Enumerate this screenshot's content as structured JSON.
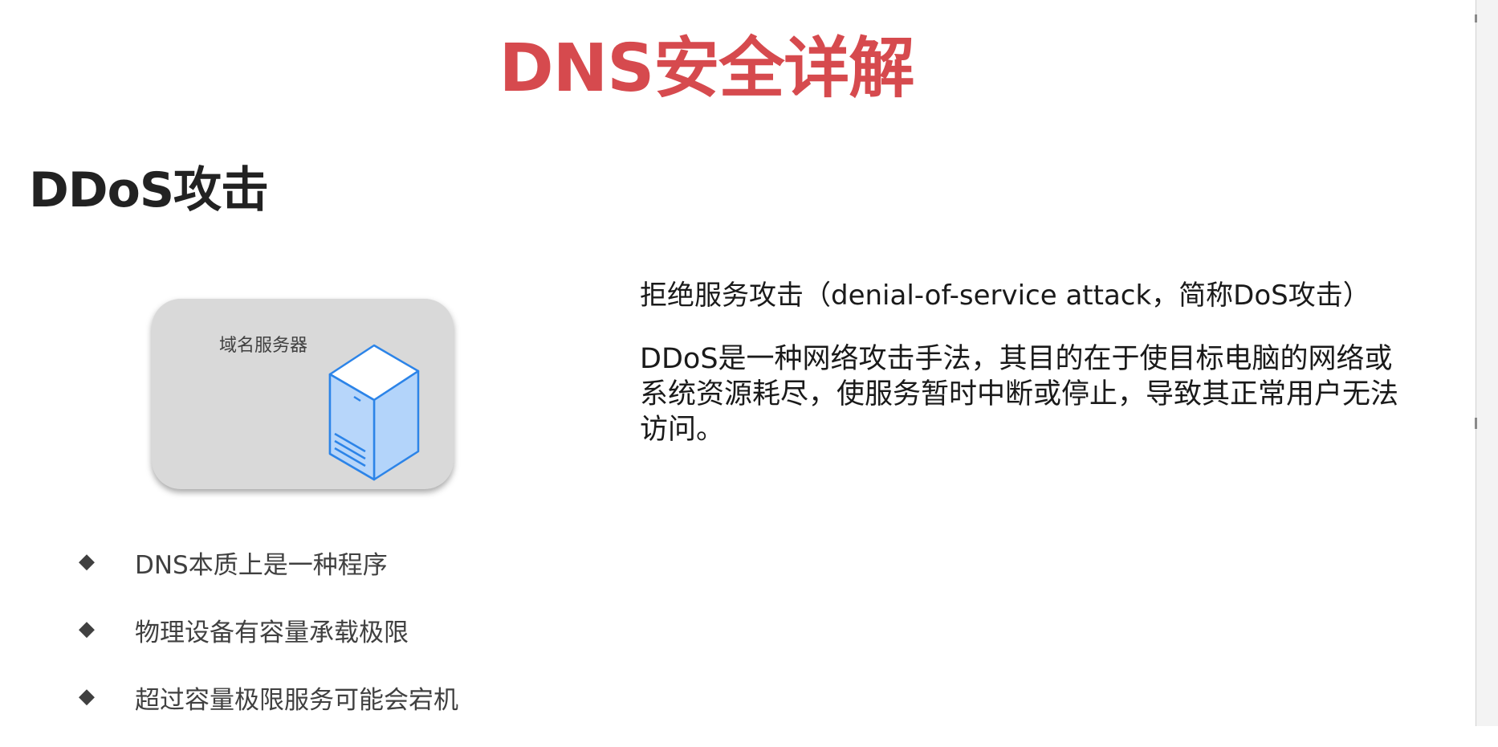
{
  "slide": {
    "title": "DNS安全详解",
    "section_title": "DDoS攻击",
    "server_label": "域名服务器",
    "bullet_glyph": "◆",
    "bullets": [
      "DNS本质上是一种程序",
      "物理设备有容量承载极限",
      "超过容量极限服务可能会宕机"
    ],
    "definition": "拒绝服务攻击（denial-of-service attack，简称DoS攻击）",
    "description": "DDoS是一种网络攻击手法，其目的在于使目标电脑的网络或系统资源耗尽，使服务暂时中断或停止，导致其正常用户无法访问。"
  },
  "colors": {
    "title": "#d64a4e",
    "server_blue": "#2c84e8",
    "server_fill": "#b3d4fa"
  },
  "icons": {
    "server": "server-icon",
    "bullet": "diamond-bullet-icon"
  }
}
